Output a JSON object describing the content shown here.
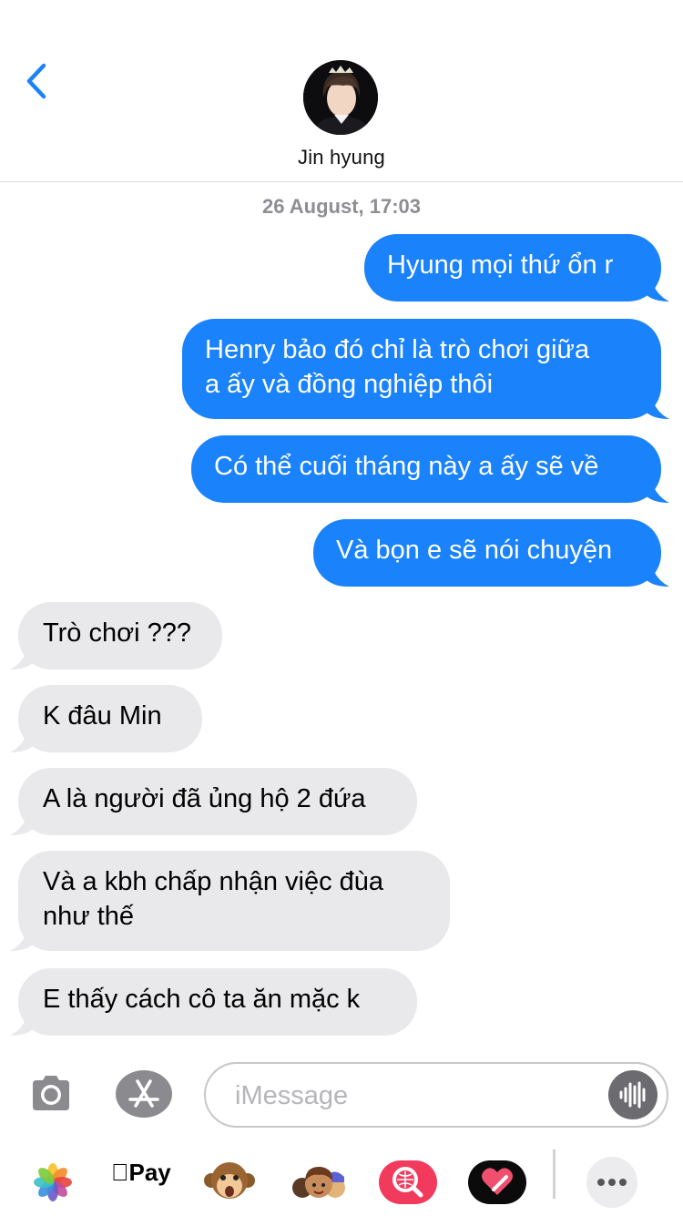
{
  "header": {
    "contact_name": "Jin hyung"
  },
  "timestamp": "26 August, 17:03",
  "messages": [
    {
      "direction": "outgoing",
      "lines": [
        "Hyung mọi thứ ổn r"
      ]
    },
    {
      "direction": "outgoing",
      "lines": [
        "Henry bảo đó chỉ là trò chơi giữa",
        "a ấy và đồng nghiệp thôi"
      ]
    },
    {
      "direction": "outgoing",
      "lines": [
        "Có thể cuối tháng này a ấy sẽ về"
      ]
    },
    {
      "direction": "outgoing",
      "lines": [
        "Và bọn e sẽ nói chuyện"
      ]
    },
    {
      "direction": "incoming",
      "lines": [
        "Trò chơi ???"
      ]
    },
    {
      "direction": "incoming",
      "lines": [
        "K đâu Min"
      ]
    },
    {
      "direction": "incoming",
      "lines": [
        "A là người đã ủng hộ 2 đứa"
      ]
    },
    {
      "direction": "incoming",
      "lines": [
        "Và a kbh chấp nhận việc đùa",
        "như thế"
      ]
    },
    {
      "direction": "incoming",
      "lines": [
        "E thấy cách cô ta ăn mặc k"
      ]
    }
  ],
  "composer": {
    "placeholder": "iMessage",
    "value": ""
  },
  "app_drawer": {
    "apple_pay_label": "Pay",
    "apps": [
      "photos-icon",
      "apple-pay-icon",
      "animoji-monkey-icon",
      "memoji-icon",
      "image-search-icon",
      "digital-touch-icon",
      "more-icon"
    ]
  },
  "colors": {
    "outgoing_bubble": "#1a82fb",
    "incoming_bubble": "#e9e9eb",
    "accent": "#1a82fb",
    "timestamp_text": "#8e8e93"
  }
}
